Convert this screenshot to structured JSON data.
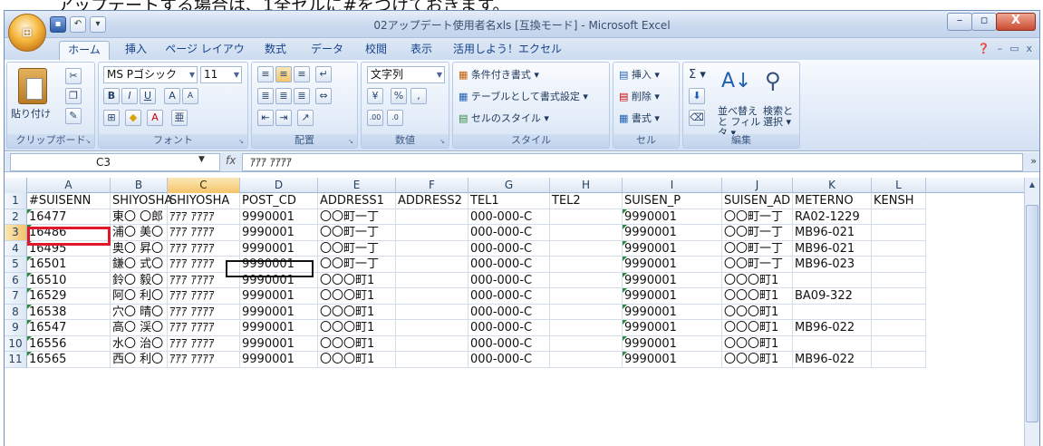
{
  "doc_text": "アップデートする場合は、1全セルに#をつけておきます。",
  "titlebar": {
    "title": "02アップデート使用者名xls  [互換モード] - Microsoft Excel",
    "qat": [
      "save-icon",
      "undo-icon",
      "customize-icon"
    ],
    "controls": {
      "min": "–",
      "max": "▫",
      "close": "X"
    }
  },
  "office_button": "Office",
  "tabs": [
    "ホーム",
    "挿入",
    "ページ レイアウト",
    "数式",
    "データ",
    "校閲",
    "表示",
    "活用しよう！エクセル"
  ],
  "tab_right": {
    "help": "❓",
    "min": "–",
    "restore": "▭",
    "close": "x"
  },
  "ribbon": {
    "clipboard": {
      "label": "クリップボード",
      "paste": "貼り付け"
    },
    "font": {
      "label": "フォント",
      "name": "MS Pゴシック",
      "size": "11",
      "bold": "B",
      "italic": "I",
      "underline": "U"
    },
    "alignment": {
      "label": "配置"
    },
    "number": {
      "label": "数値",
      "format": "文字列",
      "percent": "%",
      "comma": ","
    },
    "styles": {
      "label": "スタイル",
      "conditional": "条件付き書式 ▾",
      "table": "テーブルとして書式設定 ▾",
      "cell": "セルのスタイル ▾"
    },
    "cells": {
      "label": "セル",
      "insert": "挿入 ▾",
      "delete": "削除 ▾",
      "format": "書式 ▾"
    },
    "editing": {
      "label": "編集",
      "sum": "Σ ▾",
      "sort": "並べ替えと フィルタ ▾",
      "find": "検索と 選択 ▾"
    }
  },
  "formula_bar": {
    "name_box": "C3",
    "fx": "fx",
    "formula": "ｱｱｱ ｱｱｱｱ"
  },
  "columns": [
    "A",
    "B",
    "C",
    "D",
    "E",
    "F",
    "G",
    "H",
    "I",
    "J",
    "K",
    "L"
  ],
  "selected_column": "C",
  "selected_row": "3",
  "rows": [
    {
      "num": "1",
      "cells": [
        "#SUISENN",
        "SHIYOSHA",
        "SHIYOSHA",
        "POST_CD",
        "ADDRESS1",
        "ADDRESS2",
        "TEL1",
        "TEL2",
        "SUISEN_P",
        "SUISEN_AD",
        "METERNO",
        "KENSH"
      ]
    },
    {
      "num": "2",
      "cells": [
        "16477",
        "東〇 〇郎",
        "ｱｱｱ ｱｱｱｱ",
        "9990001",
        "〇〇町一丁",
        "",
        "000-000-C",
        "",
        "9990001",
        "〇〇町一丁",
        "RA02-1229",
        ""
      ]
    },
    {
      "num": "3",
      "cells": [
        "16486",
        "浦〇 美〇",
        "ｱｱｱ ｱｱｱｱ",
        "9990001",
        "〇〇町一丁",
        "",
        "000-000-C",
        "",
        "9990001",
        "〇〇町一丁",
        "MB96-021",
        ""
      ]
    },
    {
      "num": "4",
      "cells": [
        "16495",
        "奥〇 昇〇",
        "ｱｱｱ ｱｱｱｱ",
        "9990001",
        "〇〇町一丁",
        "",
        "000-000-C",
        "",
        "9990001",
        "〇〇町一丁",
        "MB96-021",
        ""
      ]
    },
    {
      "num": "5",
      "cells": [
        "16501",
        "鎌〇 式〇",
        "ｱｱｱ ｱｱｱｱ",
        "9990001",
        "〇〇町一丁",
        "",
        "000-000-C",
        "",
        "9990001",
        "〇〇町一丁",
        "MB96-023",
        ""
      ]
    },
    {
      "num": "6",
      "cells": [
        "16510",
        "鈴〇 毅〇",
        "ｱｱｱ ｱｱｱｱ",
        "9990001",
        "〇〇〇町1",
        "",
        "000-000-C",
        "",
        "9990001",
        "〇〇〇町1",
        "",
        ""
      ]
    },
    {
      "num": "7",
      "cells": [
        "16529",
        "阿〇 利〇",
        "ｱｱｱ ｱｱｱｱ",
        "9990001",
        "〇〇〇町1",
        "",
        "000-000-C",
        "",
        "9990001",
        "〇〇〇町1",
        "BA09-322",
        ""
      ]
    },
    {
      "num": "8",
      "cells": [
        "16538",
        "穴〇 晴〇",
        "ｱｱｱ ｱｱｱｱ",
        "9990001",
        "〇〇〇町1",
        "",
        "000-000-C",
        "",
        "9990001",
        "〇〇〇町1",
        "",
        ""
      ]
    },
    {
      "num": "9",
      "cells": [
        "16547",
        "高〇 渓〇",
        "ｱｱｱ ｱｱｱｱ",
        "9990001",
        "〇〇〇町1",
        "",
        "000-000-C",
        "",
        "9990001",
        "〇〇〇町1",
        "MB96-022",
        ""
      ]
    },
    {
      "num": "10",
      "cells": [
        "16556",
        "水〇 治〇",
        "ｱｱｱ ｱｱｱｱ",
        "9990001",
        "〇〇〇町1",
        "",
        "000-000-C",
        "",
        "9990001",
        "〇〇〇町1",
        "",
        ""
      ]
    },
    {
      "num": "11",
      "cells": [
        "16565",
        "西〇 利〇",
        "ｱｱｱ ｱｱｱｱ",
        "9990001",
        "〇〇〇町1",
        "",
        "000-000-C",
        "",
        "9990001",
        "〇〇〇町1",
        "MB96-022",
        ""
      ]
    }
  ]
}
